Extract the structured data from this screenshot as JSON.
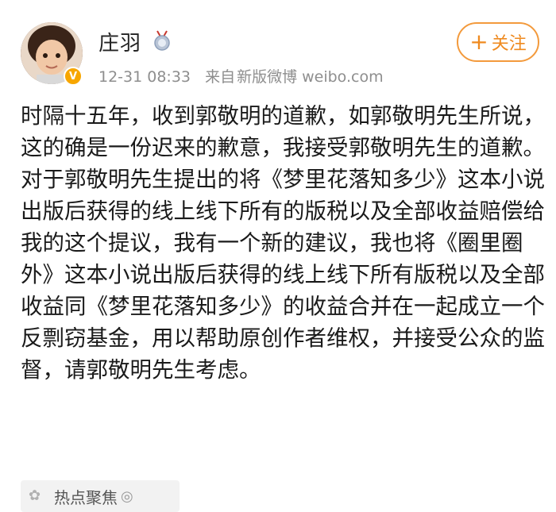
{
  "post": {
    "author": "庄羽",
    "time": "12-31 08:33",
    "source_prefix": "来自",
    "source": "新版微博 weibo.com",
    "follow_label": "关注",
    "paragraphs": [
      "时隔十五年，收到郭敬明的道歉，如郭敬明先生所说，这的确是一份迟来的歉意，我接受郭敬明先生的道歉。",
      "对于郭敬明先生提出的将《梦里花落知多少》这本小说出版后获得的线上线下所有的版税以及全部收益赔偿给我的这个提议，我有一个新的建议，我也将《圈里圈外》这本小说出版后获得的线上线下所有版税以及全部收益同《梦里花落知多少》的收益合并在一起成立一个反剽窃基金，用以帮助原创作者维权，并接受公众的监督，请郭敬明先生考虑。"
    ],
    "topic_label": "热点聚焦"
  },
  "colors": {
    "accent_orange": "#ef8a1f",
    "verified_gold": "#f7a600",
    "meta_gray": "#8e8e8e"
  },
  "icons": {
    "avatar": "user-avatar",
    "verified": "verified-v-icon",
    "medal": "medal-icon",
    "plus": "plus-icon"
  }
}
